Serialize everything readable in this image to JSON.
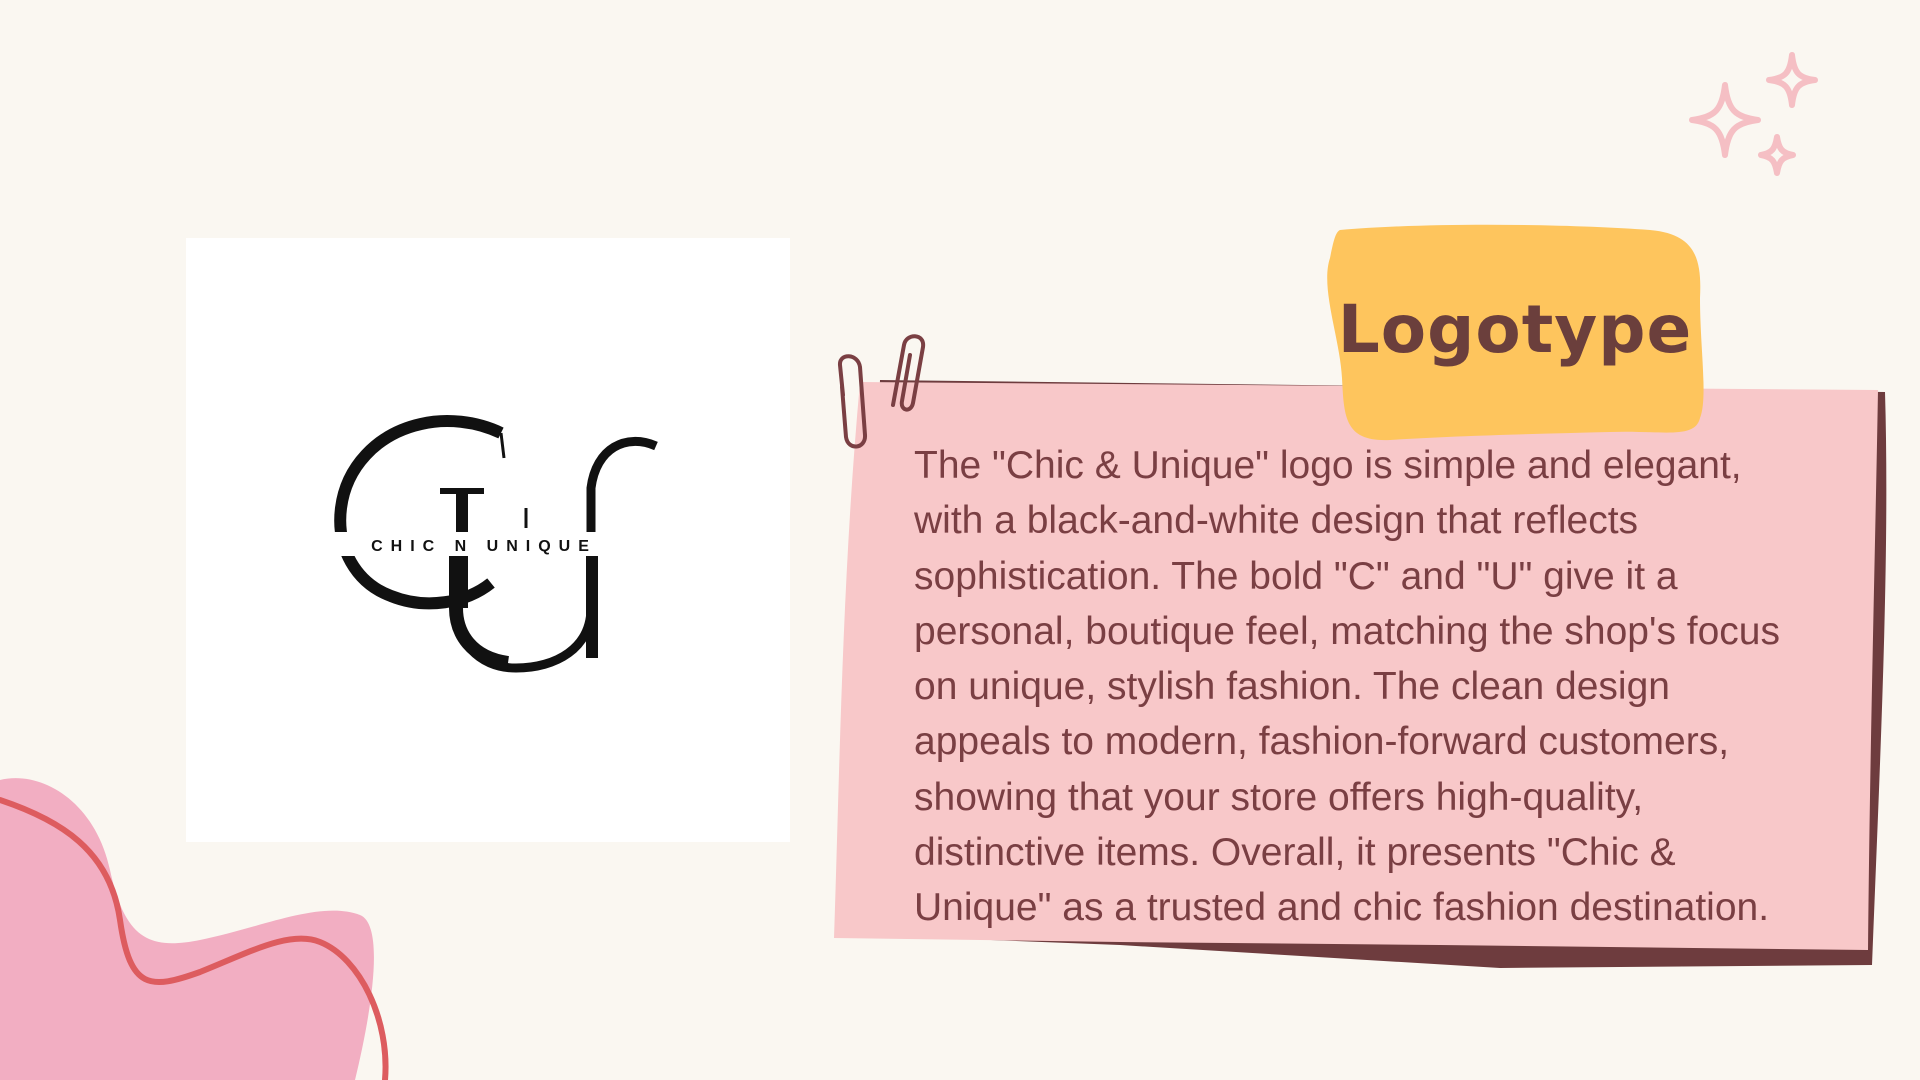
{
  "slide": {
    "title": "Logotype",
    "description": "The \"Chic & Unique\" logo is simple and elegant, with a black-and-white design that reflects sophistication. The bold \"C\" and \"U\" give it a personal, boutique feel, matching the shop's focus on unique, stylish fashion. The clean design appeals to modern, fashion-forward customers, showing that your store offers high-quality, distinctive items. Overall, it presents \"Chic & Unique\" as a trusted and chic fashion destination.",
    "description_lines": [
      "The \"Chic & Unique\" logo is simple and elegant,",
      "with a black-and-white design that reflects",
      "sophistication. The bold \"C\" and \"U\" give it a",
      "personal, boutique feel, matching the shop's focus",
      "on unique, stylish fashion. The clean design",
      "appeals to modern, fashion-forward customers,",
      "showing that your store offers high-quality,",
      "distinctive items. Overall, it presents \"Chic &",
      "Unique\" as a trusted and chic fashion destination."
    ]
  },
  "logo": {
    "wordmark": "CHIC N UNIQUE",
    "monogram": "CU"
  },
  "colors": {
    "background": "#faf7f1",
    "note": "#f8c8c9",
    "note_shadow": "#6e3c3e",
    "tag": "#fec55d",
    "title_text": "#6b3f3c",
    "body_text": "#7a3f43",
    "sparkle": "#f5bfc4",
    "blob_fill": "#f2aec2",
    "blob_line": "#dd5c5f"
  },
  "icons": [
    "paperclip-icon",
    "sparkle-icon",
    "blob-shape"
  ]
}
